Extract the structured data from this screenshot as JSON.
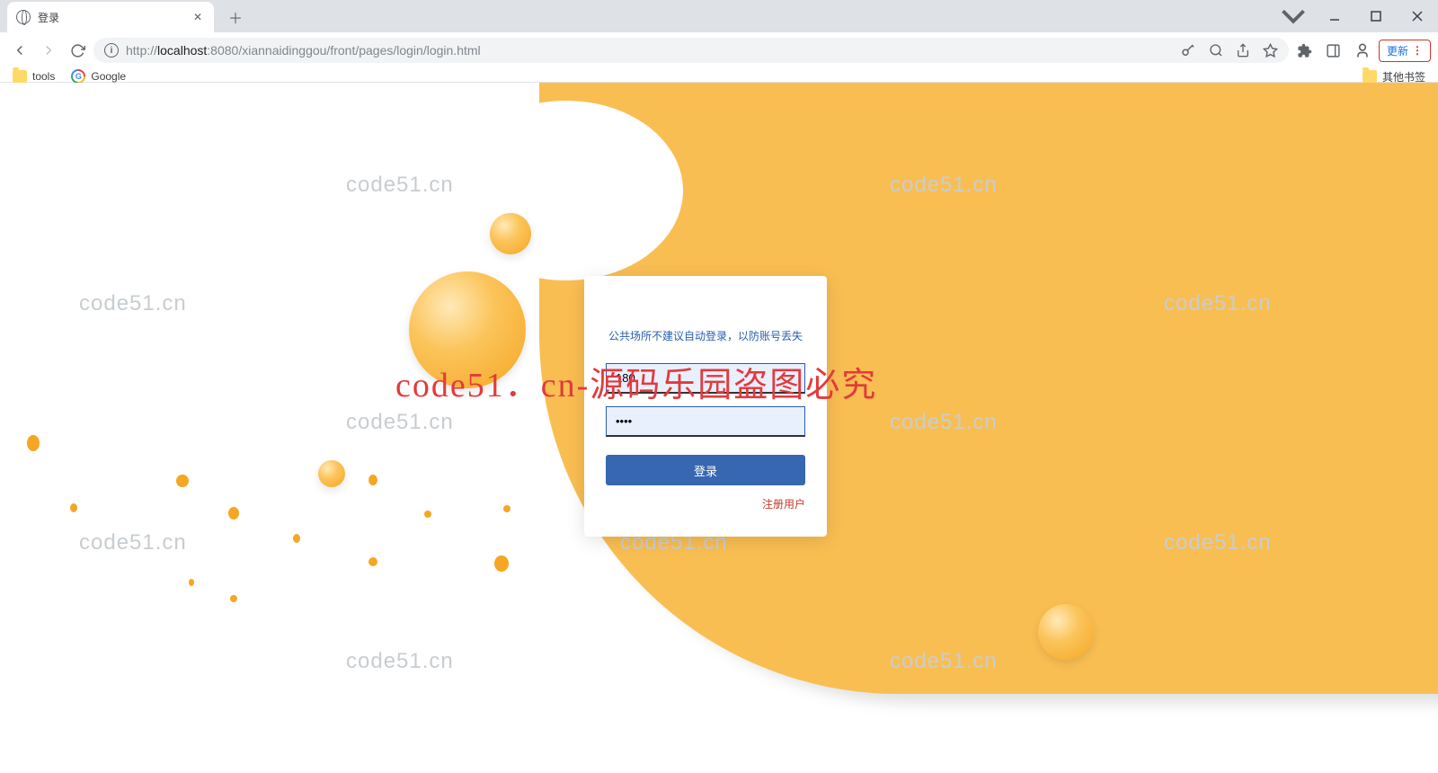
{
  "browser": {
    "tab_title": "登录",
    "url_scheme": "http://",
    "url_host": "localhost",
    "url_port": ":8080",
    "url_path": "/xiannaidinggou/front/pages/login/login.html",
    "update_label": "更新",
    "bookmarks": {
      "tools": "tools",
      "google": "Google",
      "other": "其他书签"
    }
  },
  "login": {
    "tip": "公共场所不建议自动登录，以防账号丢失",
    "username_value": "180",
    "password_value": "••••",
    "button_label": "登录",
    "register_label": "注册用户"
  },
  "watermark": {
    "text": "code51.cn",
    "overlay": "code51．cn-源码乐园盗图必究"
  }
}
